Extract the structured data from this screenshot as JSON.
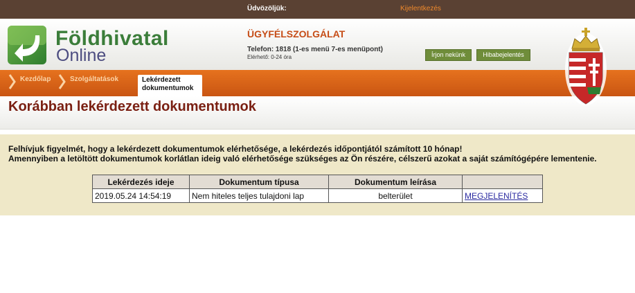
{
  "topbar": {
    "greeting": "Üdvözöljük:",
    "logout": "Kijelentkezés"
  },
  "logo": {
    "title": "Földhivatal",
    "subtitle": "Online",
    "icon": "green-arrow-down-left-icon"
  },
  "header": {
    "service_title": "ÜGYFÉLSZOLGÁLAT",
    "phone": "Telefon: 1818 (1-es menü 7-es menüpont)",
    "availability": "Elérhető: 0-24 óra",
    "contact_button": "Írjon nekünk",
    "bug_button": "Hibabejelentés",
    "coat_of_arms_icon": "hungarian-coat-of-arms-icon"
  },
  "nav": {
    "items": [
      {
        "label": "Kezdőlap"
      },
      {
        "label": "Szolgáltatások"
      }
    ],
    "active_line1": "Lekérdezett",
    "active_line2": "dokumentumok"
  },
  "page": {
    "title": "Korábban lekérdezett dokumentumok"
  },
  "notice": {
    "line1": "Felhívjuk figyelmét, hogy a lekérdezett dokumentumok elérhetősége, a lekérdezés időpontjától számított 10 hónap!",
    "line2": "Amennyiben a letöltött dokumentumok korlátlan ideig való elérhetősége szükséges az Ön részére, célszerű azokat a saját számítógépére lementenie."
  },
  "table": {
    "headers": [
      "Lekérdezés ideje",
      "Dokumentum típusa",
      "Dokumentum leírása",
      ""
    ],
    "rows": [
      {
        "time": "2019.05.24 14:54:19",
        "type": "Nem hiteles teljes tulajdoni lap",
        "description": "belterület",
        "action": "MEGJELENÍTÉS"
      }
    ]
  },
  "colors": {
    "topbar": "#5a4133",
    "nav_orange": "#e6721e",
    "title_red": "#7a1f12",
    "accent_orange": "#c64d17",
    "content_bg": "#efe8c8",
    "button_green": "#6f8d3a"
  }
}
